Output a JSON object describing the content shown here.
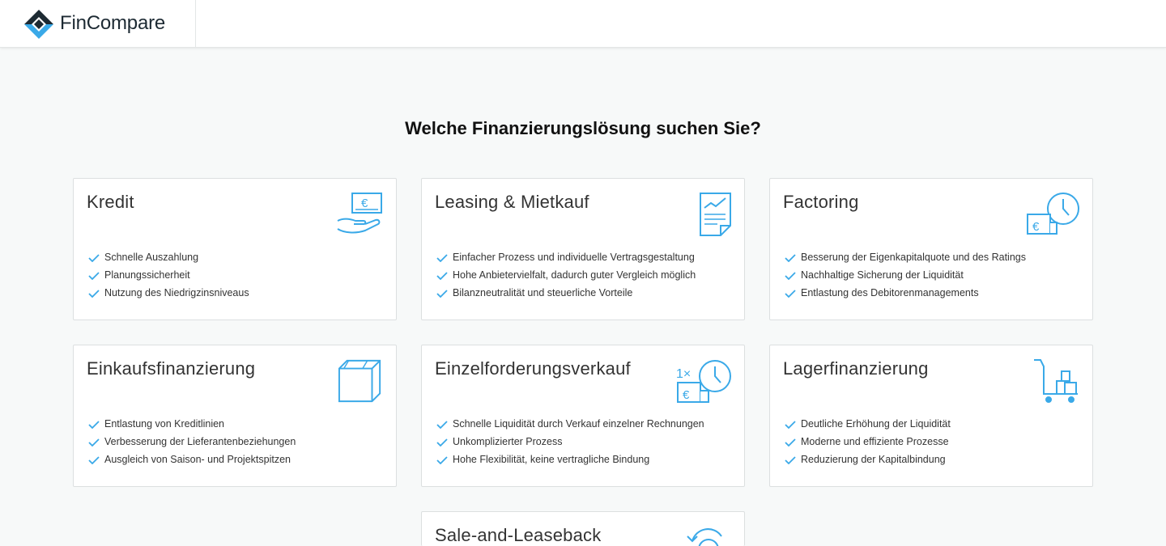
{
  "brand": {
    "name": "FinCompare",
    "color_dark": "#1d2a33",
    "color_accent": "#3aa9e8"
  },
  "main": {
    "title": "Welche Finanzierungslösung suchen Sie?",
    "cards": [
      {
        "title": "Kredit",
        "icon": "hand-money-icon",
        "benefits": [
          "Schnelle Auszahlung",
          "Planungssicherheit",
          "Nutzung des Niedrigzinsniveaus"
        ]
      },
      {
        "title": "Leasing & Mietkauf",
        "icon": "contract-chart-icon",
        "benefits": [
          "Einfacher Prozess und individuelle Vertragsgestaltung",
          "Hohe Anbietervielfalt, dadurch guter Vergleich möglich",
          "Bilanzneutralität und steuerliche Vorteile"
        ]
      },
      {
        "title": "Factoring",
        "icon": "invoice-clock-icon",
        "benefits": [
          "Besserung der Eigenkapitalquote und des Ratings",
          "Nachhaltige Sicherung der Liquidität",
          "Entlastung des Debitorenmanagements"
        ]
      },
      {
        "title": "Einkaufsfinanzierung",
        "icon": "box-icon",
        "benefits": [
          "Entlastung von Kreditlinien",
          "Verbesserung der Lieferantenbeziehungen",
          "Ausgleich von Saison- und Projektspitzen"
        ]
      },
      {
        "title": "Einzelforderungsverkauf",
        "icon": "single-invoice-clock-icon",
        "benefits": [
          "Schnelle Liquidität durch Verkauf einzelner Rechnungen",
          "Unkomplizierter Prozess",
          "Hohe Flexibilität, keine vertragliche Bindung"
        ]
      },
      {
        "title": "Lagerfinanzierung",
        "icon": "cart-boxes-icon",
        "benefits": [
          "Deutliche Erhöhung der Liquidität",
          "Moderne und effiziente Prozesse",
          "Reduzierung der Kapitalbindung"
        ]
      },
      {
        "title": "Sale-and-Leaseback",
        "icon": "leaseback-icon",
        "benefits": []
      }
    ]
  }
}
